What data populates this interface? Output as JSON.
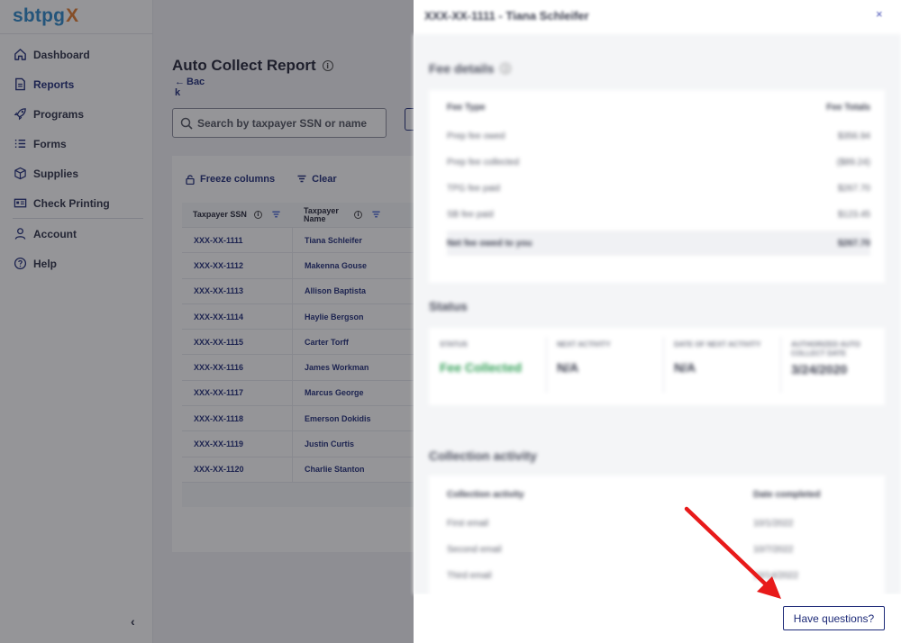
{
  "sidebar": {
    "logo_main": "sbtpg",
    "logo_x": "X",
    "items": [
      {
        "label": "Dashboard",
        "icon": "home-icon"
      },
      {
        "label": "Reports",
        "icon": "document-icon",
        "active": true
      },
      {
        "label": "Programs",
        "icon": "rocket-icon"
      },
      {
        "label": "Forms",
        "icon": "list-icon"
      },
      {
        "label": "Supplies",
        "icon": "box-icon"
      },
      {
        "label": "Check Printing",
        "icon": "check-printing-icon"
      },
      {
        "label": "Account",
        "icon": "user-icon"
      },
      {
        "label": "Help",
        "icon": "help-icon"
      }
    ],
    "collapse_label": "‹"
  },
  "main": {
    "title": "Auto Collect Report",
    "back_label": "Bac k",
    "search_placeholder": "Search by taxpayer SSN or name",
    "toolbar": {
      "freeze_label": "Freeze columns",
      "clear_label": "Clear"
    },
    "table": {
      "headers": [
        "Taxpayer SSN",
        "Taxpayer Name"
      ],
      "rows": [
        {
          "ssn": "XXX-XX-1111",
          "name": "Tiana Schleifer"
        },
        {
          "ssn": "XXX-XX-1112",
          "name": "Makenna Gouse"
        },
        {
          "ssn": "XXX-XX-1113",
          "name": "Allison Baptista"
        },
        {
          "ssn": "XXX-XX-1114",
          "name": "Haylie Bergson"
        },
        {
          "ssn": "XXX-XX-1115",
          "name": "Carter Torff"
        },
        {
          "ssn": "XXX-XX-1116",
          "name": "James Workman"
        },
        {
          "ssn": "XXX-XX-1117",
          "name": "Marcus George"
        },
        {
          "ssn": "XXX-XX-1118",
          "name": "Emerson Dokidis"
        },
        {
          "ssn": "XXX-XX-1119",
          "name": "Justin Curtis"
        },
        {
          "ssn": "XXX-XX-1120",
          "name": "Charlie Stanton"
        }
      ]
    }
  },
  "drawer": {
    "title": "XXX-XX-1111 - Tiana Schleifer",
    "close_label": "×",
    "fee_details": {
      "title": "Fee details",
      "header": [
        "Fee Type",
        "Fee Totals"
      ],
      "rows": [
        {
          "type": "Prep fee owed",
          "value": "$356.94"
        },
        {
          "type": "Prep fee collected",
          "value": "($89.24)"
        },
        {
          "type": "TPG fee paid",
          "value": "$267.70"
        },
        {
          "type": "SB fee paid",
          "value": "$123.45"
        },
        {
          "type": "Net fee owed to you",
          "value": "$267.70"
        }
      ]
    },
    "status": {
      "title": "Status",
      "columns": [
        {
          "label": "STATUS",
          "value": "Fee Collected"
        },
        {
          "label": "NEXT ACTIVITY",
          "value": "N/A"
        },
        {
          "label": "DATE OF NEXT ACTIVITY",
          "value": "N/A"
        },
        {
          "label": "AUTHORIZED AUTO COLLECT DATE",
          "value": "3/24/2020"
        }
      ]
    },
    "collection": {
      "title": "Collection activity",
      "header": [
        "Collection activity",
        "Date completed"
      ],
      "rows": [
        {
          "activity": "First email",
          "date": "10/1/2022"
        },
        {
          "activity": "Second email",
          "date": "10/7/2022"
        },
        {
          "activity": "Third email",
          "date": "10/14/2022"
        }
      ]
    },
    "help_button": "Have questions?"
  },
  "colors": {
    "brand_blue": "#2a86c8",
    "brand_orange": "#e07a2d",
    "navy": "#1d2a78",
    "success_green": "#2f9e54",
    "annotation_red": "#e81a1a"
  }
}
